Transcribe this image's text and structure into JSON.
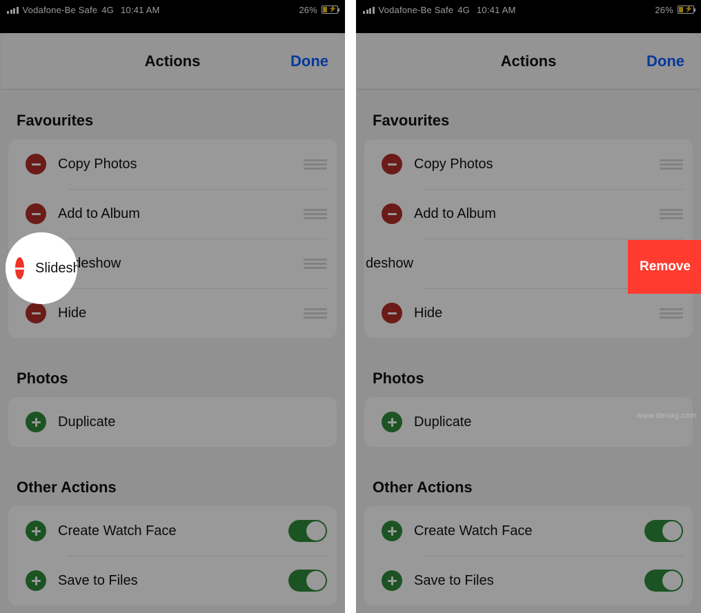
{
  "status": {
    "carrier": "Vodafone-Be Safe",
    "network": "4G",
    "time": "10:41 AM",
    "battery_pct": "26%"
  },
  "header": {
    "title": "Actions",
    "done": "Done"
  },
  "sections": {
    "favourites_h": "Favourites",
    "photos_h": "Photos",
    "other_h": "Other Actions"
  },
  "fav": {
    "copy": "Copy Photos",
    "add_album": "Add to Album",
    "slideshow": "Slideshow",
    "slideshow_partial": "deshow",
    "hide": "Hide"
  },
  "photos": {
    "duplicate": "Duplicate"
  },
  "other": {
    "watch_face": "Create Watch Face",
    "save_files": "Save to Files"
  },
  "remove_label": "Remove",
  "watermark": "www.deuag.com"
}
